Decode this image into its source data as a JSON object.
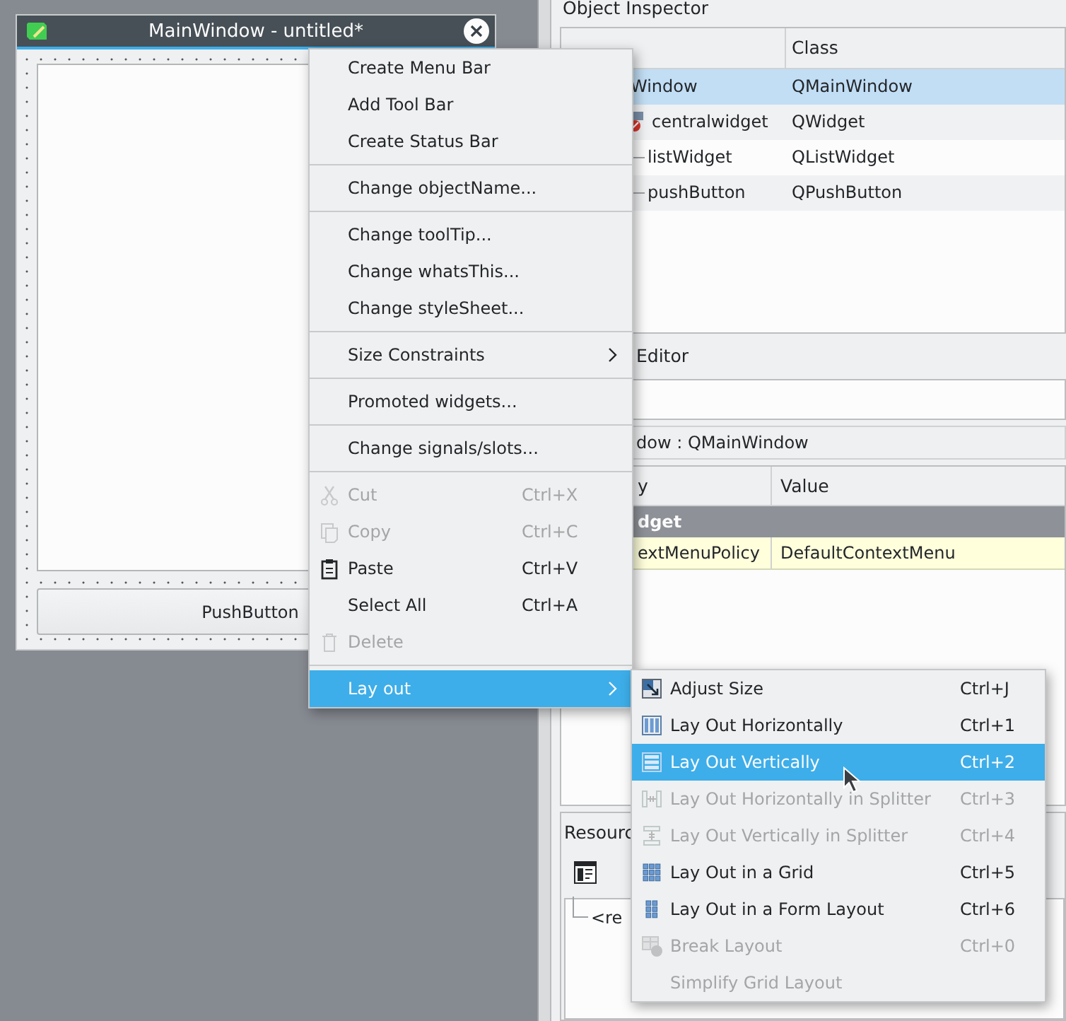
{
  "form_window": {
    "title": "MainWindow - untitled*",
    "push_button": "PushButton"
  },
  "object_inspector": {
    "title": "Object Inspector",
    "class_header": "Class",
    "rows": [
      {
        "object": "Window",
        "class": "QMainWindow",
        "selected": true,
        "children": [
          {
            "object": "centralwidget",
            "class": "QWidget",
            "selected": false,
            "children": [
              {
                "object": "listWidget",
                "class": "QListWidget",
                "selected": false
              },
              {
                "object": "pushButton",
                "class": "QPushButton",
                "selected": false
              }
            ]
          }
        ]
      }
    ]
  },
  "property_editor": {
    "title": "Editor",
    "class_label": "dow : QMainWindow",
    "columns": [
      "y",
      "Value"
    ],
    "groups": [
      {
        "name": "dget",
        "properties": [
          {
            "name": "extMenuPolicy",
            "value": "DefaultContextMenu",
            "changed": true
          }
        ]
      }
    ]
  },
  "resource_browser": {
    "title": "Resourc",
    "tree": [
      "<re"
    ]
  },
  "context_menu": {
    "items": [
      {
        "kind": "action",
        "label": "Create Menu Bar",
        "disabled": false,
        "selected": false
      },
      {
        "kind": "action",
        "label": "Add Tool Bar",
        "disabled": false,
        "selected": false
      },
      {
        "kind": "action",
        "label": "Create Status Bar",
        "disabled": false,
        "selected": false
      },
      {
        "kind": "separator"
      },
      {
        "kind": "action",
        "label": "Change objectName...",
        "disabled": false,
        "selected": false
      },
      {
        "kind": "separator"
      },
      {
        "kind": "action",
        "label": "Change toolTip...",
        "disabled": false,
        "selected": false
      },
      {
        "kind": "action",
        "label": "Change whatsThis...",
        "disabled": false,
        "selected": false
      },
      {
        "kind": "action",
        "label": "Change styleSheet...",
        "disabled": false,
        "selected": false
      },
      {
        "kind": "separator"
      },
      {
        "kind": "submenu",
        "label": "Size Constraints",
        "disabled": false,
        "selected": false
      },
      {
        "kind": "separator"
      },
      {
        "kind": "action",
        "label": "Promoted widgets...",
        "disabled": false,
        "selected": false
      },
      {
        "kind": "separator"
      },
      {
        "kind": "action",
        "label": "Change signals/slots...",
        "disabled": false,
        "selected": false
      },
      {
        "kind": "separator"
      },
      {
        "kind": "action",
        "label": "Cut",
        "shortcut": "Ctrl+X",
        "disabled": true,
        "selected": false
      },
      {
        "kind": "action",
        "label": "Copy",
        "shortcut": "Ctrl+C",
        "disabled": true,
        "selected": false
      },
      {
        "kind": "action",
        "label": "Paste",
        "shortcut": "Ctrl+V",
        "disabled": false,
        "selected": false
      },
      {
        "kind": "action",
        "label": "Select All",
        "shortcut": "Ctrl+A",
        "disabled": false,
        "selected": false
      },
      {
        "kind": "action",
        "label": "Delete",
        "disabled": true,
        "selected": false
      },
      {
        "kind": "separator"
      },
      {
        "kind": "submenu",
        "label": "Lay out",
        "disabled": false,
        "selected": true
      }
    ]
  },
  "layout_submenu": {
    "items": [
      {
        "kind": "action",
        "label": "Adjust Size",
        "shortcut": "Ctrl+J",
        "disabled": false,
        "selected": false
      },
      {
        "kind": "action",
        "label": "Lay Out Horizontally",
        "shortcut": "Ctrl+1",
        "disabled": false,
        "selected": false
      },
      {
        "kind": "action",
        "label": "Lay Out Vertically",
        "shortcut": "Ctrl+2",
        "disabled": false,
        "selected": true
      },
      {
        "kind": "action",
        "label": "Lay Out Horizontally in Splitter",
        "shortcut": "Ctrl+3",
        "disabled": true,
        "selected": false
      },
      {
        "kind": "action",
        "label": "Lay Out Vertically in Splitter",
        "shortcut": "Ctrl+4",
        "disabled": true,
        "selected": false
      },
      {
        "kind": "action",
        "label": "Lay Out in a Grid",
        "shortcut": "Ctrl+5",
        "disabled": false,
        "selected": false
      },
      {
        "kind": "action",
        "label": "Lay Out in a Form Layout",
        "shortcut": "Ctrl+6",
        "disabled": false,
        "selected": false
      },
      {
        "kind": "action",
        "label": "Break Layout",
        "shortcut": "Ctrl+0",
        "disabled": true,
        "selected": false
      },
      {
        "kind": "action",
        "label": "Simplify Grid Layout",
        "disabled": true,
        "selected": false
      }
    ]
  }
}
